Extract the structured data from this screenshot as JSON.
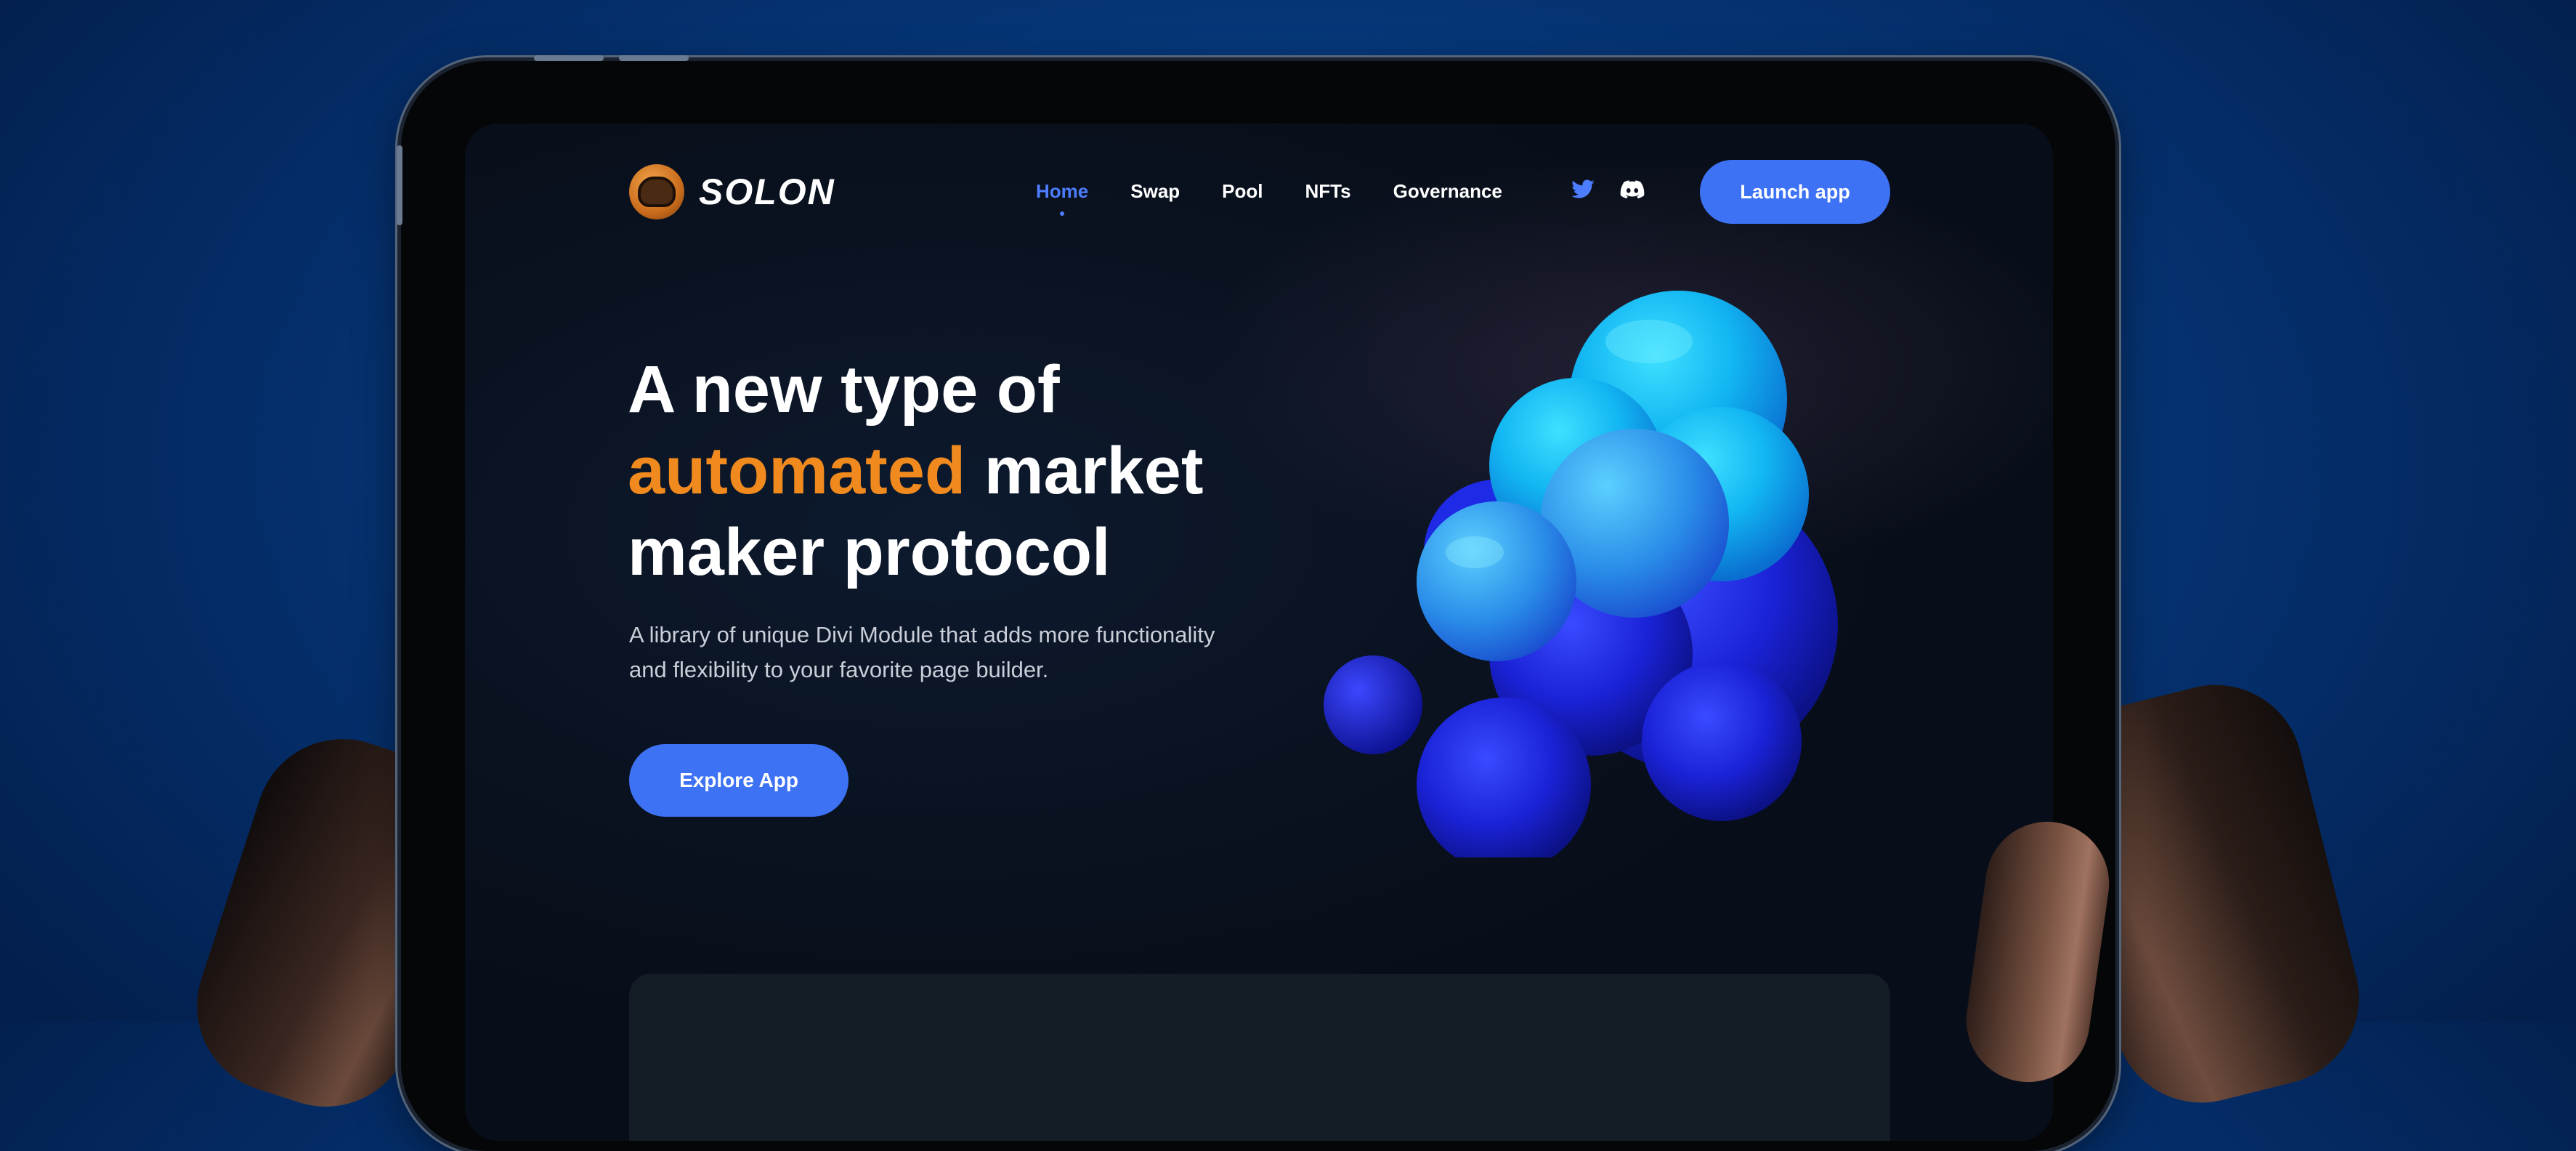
{
  "brand": {
    "name": "SOLON",
    "logo_icon": "solon-helmet-logo-icon",
    "accent_color": "#f08a1e"
  },
  "nav": {
    "items": [
      {
        "label": "Home",
        "active": true
      },
      {
        "label": "Swap",
        "active": false
      },
      {
        "label": "Pool",
        "active": false
      },
      {
        "label": "NFTs",
        "active": false
      },
      {
        "label": "Governance",
        "active": false
      }
    ],
    "active_color": "#4d7dff"
  },
  "social": {
    "icons": [
      "twitter-icon",
      "discord-icon"
    ]
  },
  "launch_button": {
    "label": "Launch app",
    "color": "#3d72f5"
  },
  "hero": {
    "headline_part1": "A new type of",
    "headline_accent": "automated",
    "headline_part2": "market",
    "headline_part3": "maker protocol",
    "description_line1": "A library of unique Divi Module that adds more functionality",
    "description_line2": "and flexibility to your favorite page builder.",
    "cta_label": "Explore App",
    "illustration": "blue-3d-blob-illustration"
  }
}
